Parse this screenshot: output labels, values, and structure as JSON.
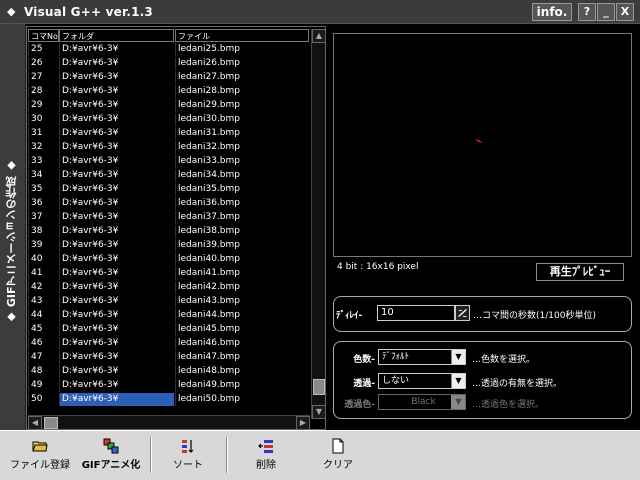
{
  "window": {
    "title": "Visual G++ ver.1.3",
    "info_label": "info.",
    "help_label": "?",
    "minimize_label": "_",
    "close_label": "X"
  },
  "side_tab": {
    "label": "◆ GIFアニメーションの作成 ◆"
  },
  "list": {
    "columns": [
      "コマNo.",
      "フォルダ",
      "ファイル"
    ],
    "rows": [
      {
        "no": "25",
        "folder": "D:¥avr¥6-3¥",
        "file": "ledani25.bmp"
      },
      {
        "no": "26",
        "folder": "D:¥avr¥6-3¥",
        "file": "ledani26.bmp"
      },
      {
        "no": "27",
        "folder": "D:¥avr¥6-3¥",
        "file": "ledani27.bmp"
      },
      {
        "no": "28",
        "folder": "D:¥avr¥6-3¥",
        "file": "ledani28.bmp"
      },
      {
        "no": "29",
        "folder": "D:¥avr¥6-3¥",
        "file": "ledani29.bmp"
      },
      {
        "no": "30",
        "folder": "D:¥avr¥6-3¥",
        "file": "ledani30.bmp"
      },
      {
        "no": "31",
        "folder": "D:¥avr¥6-3¥",
        "file": "ledani31.bmp"
      },
      {
        "no": "32",
        "folder": "D:¥avr¥6-3¥",
        "file": "ledani32.bmp"
      },
      {
        "no": "33",
        "folder": "D:¥avr¥6-3¥",
        "file": "ledani33.bmp"
      },
      {
        "no": "34",
        "folder": "D:¥avr¥6-3¥",
        "file": "ledani34.bmp"
      },
      {
        "no": "35",
        "folder": "D:¥avr¥6-3¥",
        "file": "ledani35.bmp"
      },
      {
        "no": "36",
        "folder": "D:¥avr¥6-3¥",
        "file": "ledani36.bmp"
      },
      {
        "no": "37",
        "folder": "D:¥avr¥6-3¥",
        "file": "ledani37.bmp"
      },
      {
        "no": "38",
        "folder": "D:¥avr¥6-3¥",
        "file": "ledani38.bmp"
      },
      {
        "no": "39",
        "folder": "D:¥avr¥6-3¥",
        "file": "ledani39.bmp"
      },
      {
        "no": "40",
        "folder": "D:¥avr¥6-3¥",
        "file": "ledani40.bmp"
      },
      {
        "no": "41",
        "folder": "D:¥avr¥6-3¥",
        "file": "ledani41.bmp"
      },
      {
        "no": "42",
        "folder": "D:¥avr¥6-3¥",
        "file": "ledani42.bmp"
      },
      {
        "no": "43",
        "folder": "D:¥avr¥6-3¥",
        "file": "ledani43.bmp"
      },
      {
        "no": "44",
        "folder": "D:¥avr¥6-3¥",
        "file": "ledani44.bmp"
      },
      {
        "no": "45",
        "folder": "D:¥avr¥6-3¥",
        "file": "ledani45.bmp"
      },
      {
        "no": "46",
        "folder": "D:¥avr¥6-3¥",
        "file": "ledani46.bmp"
      },
      {
        "no": "47",
        "folder": "D:¥avr¥6-3¥",
        "file": "ledani47.bmp"
      },
      {
        "no": "48",
        "folder": "D:¥avr¥6-3¥",
        "file": "ledani48.bmp"
      },
      {
        "no": "49",
        "folder": "D:¥avr¥6-3¥",
        "file": "ledani49.bmp"
      },
      {
        "no": "50",
        "folder": "D:¥avr¥6-3¥",
        "file": "ledani50.bmp",
        "selected": true
      }
    ]
  },
  "preview": {
    "info": "4 bit : 16x16 pixel",
    "play_label": "再生ﾌﾟﾚﾋﾞｭｰ",
    "sprite_color": "#ff2020"
  },
  "delay": {
    "label": "ﾃﾞｨﾚｲ-",
    "value": "10",
    "description": "…コマ間の秒数(1/100秒単位)"
  },
  "options": {
    "colors": {
      "label": "色数-",
      "value": "ﾃﾞﾌｫﾙﾄ",
      "description": "…色数を選択。"
    },
    "transparency": {
      "label": "透過-",
      "value": "しない",
      "description": "…透過の有無を選択。"
    },
    "transparent_color": {
      "label": "透過色-",
      "value": "Black",
      "description": "…透過色を選択。",
      "disabled": true
    }
  },
  "toolbar": {
    "items": [
      {
        "label": "ファイル登録",
        "icon": "folder-icon",
        "bold": false
      },
      {
        "label": "GIFアニメ化",
        "icon": "gif-anim-icon",
        "bold": true
      },
      {
        "label": "ソート",
        "icon": "sort-icon",
        "bold": false
      },
      {
        "label": "削除",
        "icon": "delete-icon",
        "bold": false
      },
      {
        "label": "クリア",
        "icon": "clear-icon",
        "bold": false
      }
    ]
  },
  "colors": {
    "selection": "#2c5fb6",
    "background": "#000000",
    "toolbar_bg": "#d8d8d8"
  }
}
